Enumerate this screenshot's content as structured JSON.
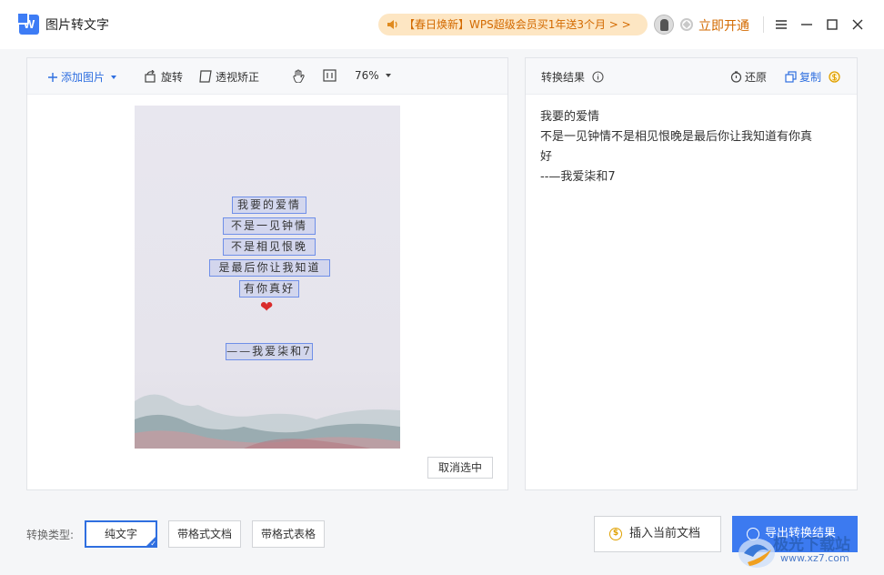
{
  "app": {
    "title": "图片转文字",
    "logo_letter": "W"
  },
  "header": {
    "promo_text": "【春日焕新】WPS超级会员买1年送3个月 > >",
    "vip_link": "立即开通",
    "window_controls": {
      "menu": "≡",
      "minimize": "—",
      "maximize": "☐",
      "close": "✕"
    }
  },
  "left_toolbar": {
    "add_image": "添加图片",
    "rotate": "旋转",
    "perspective": "透视矫正",
    "zoom": "76%"
  },
  "preview": {
    "ocr_lines": [
      "我要的爱情",
      "不是一见钟情",
      "不是相见恨晚",
      "是最后你让我知道",
      "有你真好",
      "——我爱柒和7"
    ],
    "heart": "❤",
    "deselect_button": "取消选中"
  },
  "right_panel": {
    "title": "转换结果",
    "restore": "还原",
    "copy": "复制",
    "result_lines": [
      "我要的爱情",
      "不是一见钟情不是相见恨晚是最后你让我知道有你真",
      "好",
      "--—我爱柒和7"
    ]
  },
  "bottom": {
    "type_label": "转换类型:",
    "types": [
      "纯文字",
      "带格式文档",
      "带格式表格"
    ],
    "insert_button": "插入当前文档",
    "export_button": "导出转换结果",
    "coin_symbol": "$"
  },
  "watermark": {
    "title": "极光下载站",
    "url": "www.xz7.com"
  },
  "colors": {
    "accent": "#3c7af0",
    "promo_bg": "#fde6c3",
    "promo_text": "#d36a00"
  }
}
